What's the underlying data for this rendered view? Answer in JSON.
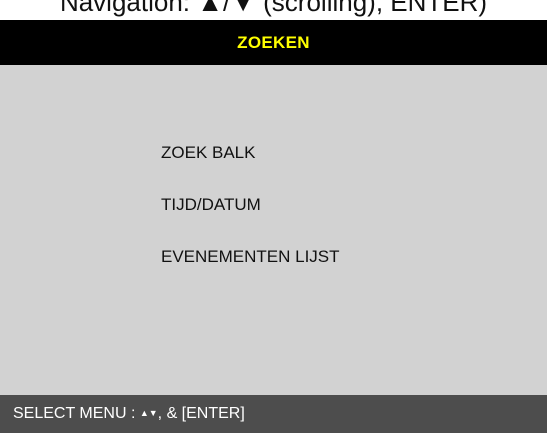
{
  "top_text": "Navigation: ▲/▼ (scrolling), ENTER)",
  "header": {
    "title": "ZOEKEN",
    "title_color": "#ffff00"
  },
  "menu": {
    "items": [
      {
        "label": "ZOEK BALK"
      },
      {
        "label": "TIJD/DATUM"
      },
      {
        "label": "EVENEMENTEN LIJST"
      }
    ]
  },
  "footer": {
    "prefix": "SELECT MENU : ",
    "arrows": "▲▼",
    "suffix": ", & [ENTER]"
  },
  "colors": {
    "header_bg": "#000000",
    "body_bg": "#d2d2d2",
    "footer_bg": "#4d4d4d"
  }
}
